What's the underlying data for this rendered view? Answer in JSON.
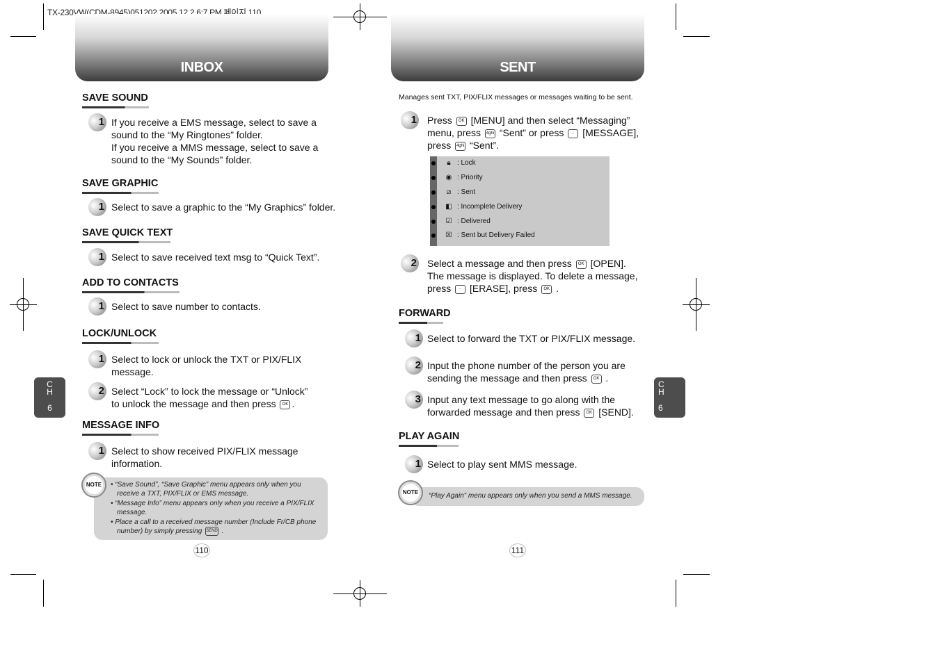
{
  "print_line": "TX-230VW(CDM-8945)051202  2005.12.2 6:7 PM 페이지 110",
  "keys": {
    "ok": "OK",
    "four": "4ghi",
    "msg": "··",
    "send": "SEND"
  },
  "left": {
    "title": "INBOX",
    "sections": [
      {
        "title": "SAVE SOUND",
        "steps": [
          {
            "n": "1",
            "lines": [
              "If you receive a EMS message, select to save a",
              "sound to the “My Ringtones” folder.",
              "If you receive a MMS message, select to save a",
              "sound to the “My Sounds” folder."
            ]
          }
        ]
      },
      {
        "title": "SAVE GRAPHIC",
        "steps": [
          {
            "n": "1",
            "lines": [
              "Select to save a graphic to the “My Graphics” folder."
            ]
          }
        ]
      },
      {
        "title": "SAVE QUICK TEXT",
        "steps": [
          {
            "n": "1",
            "lines": [
              "Select to save received text msg to “Quick Text”."
            ]
          }
        ]
      },
      {
        "title": "ADD TO CONTACTS",
        "steps": [
          {
            "n": "1",
            "lines": [
              "Select to save number to contacts."
            ]
          }
        ]
      },
      {
        "title": "LOCK/UNLOCK",
        "steps": [
          {
            "n": "1",
            "lines": [
              "Select to lock or unlock the TXT or PIX/FLIX",
              "message."
            ]
          },
          {
            "n": "2",
            "lines": [
              "Select “Lock” to lock the message or “Unlock”",
              "to unlock the message and then press",
              ". "
            ]
          }
        ]
      },
      {
        "title": "MESSAGE INFO",
        "steps": [
          {
            "n": "1",
            "lines": [
              "Select to show received PIX/FLIX message",
              "information."
            ]
          }
        ]
      }
    ],
    "note": {
      "icon_label": "NOTE",
      "lines": [
        "• “Save Sound”, “Save Graphic” menu appears only when you",
        "receive a TXT, PIX/FLIX or EMS message.",
        "• “Message Info” menu appears only when you receive a PIX/FLIX",
        "message.",
        "• Place a call to a received message number (Include Fr/CB phone",
        "number) by simply pressing",
        "."
      ]
    },
    "page_number": "110",
    "chapter": {
      "c": "C",
      "h": "H",
      "n": "6"
    }
  },
  "right": {
    "title": "SENT",
    "description": "Manages sent TXT, PIX/FLIX messages or messages waiting to be sent.",
    "step1": {
      "n": "1",
      "a": "Press",
      "b": "[MENU] and then select “Messaging”",
      "c": "menu, press",
      "d": "“Sent” or press",
      "e": "[MESSAGE],",
      "f": "press",
      "g": "“Sent”."
    },
    "icons": [
      {
        "icon": "lock-icon",
        "label": ": Lock"
      },
      {
        "icon": "priority-icon",
        "label": ": Priority"
      },
      {
        "icon": "sent-icon",
        "label": ": Sent"
      },
      {
        "icon": "incomplete-delivery-icon",
        "label": ": Incomplete Delivery"
      },
      {
        "icon": "delivered-icon",
        "label": ": Delivered"
      },
      {
        "icon": "delivery-failed-icon",
        "label": ": Sent but Delivery Failed"
      }
    ],
    "step2": {
      "n": "2",
      "a": "Select a message and then press",
      "b": "[OPEN].",
      "c": "The message is displayed. To delete a message,",
      "d": "press",
      "e": "[ERASE], press",
      "f": "."
    },
    "forward": {
      "title": "FORWARD",
      "s1": "Select to forward the TXT or PIX/FLIX message.",
      "s2a": "Input the phone number of the person you are",
      "s2b": "sending the message and then press",
      "s2c": ".",
      "s3a": "Input any text message to go along with the",
      "s3b": "forwarded message and then press",
      "s3c": "[SEND]."
    },
    "play_again": {
      "title": "PLAY AGAIN",
      "s1": "Select to play sent MMS message."
    },
    "note": {
      "icon_label": "NOTE",
      "text": "“Play Again” menu appears only when you send a MMS message."
    },
    "page_number": "111",
    "chapter": {
      "c": "C",
      "h": "H",
      "n": "6"
    }
  }
}
